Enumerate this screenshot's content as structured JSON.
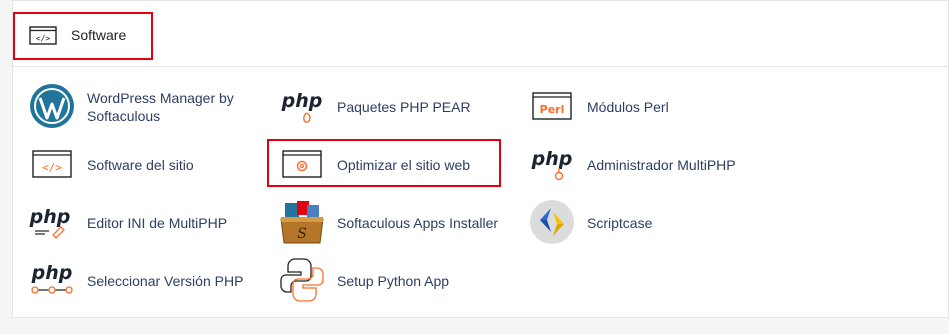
{
  "section": {
    "title": "Software",
    "icon": "code-window-icon"
  },
  "items": [
    {
      "label": "WordPress Manager by",
      "label2": "Softaculous",
      "icon": "wordpress-icon"
    },
    {
      "label": "Paquetes PHP PEAR",
      "icon": "php-pear-icon"
    },
    {
      "label": "Módulos Perl",
      "icon": "perl-icon",
      "icon_text": "Perl"
    },
    {
      "label": "Software del sitio",
      "icon": "code-window-icon"
    },
    {
      "label": "Optimizar el sitio web",
      "icon": "gear-window-icon"
    },
    {
      "label": "Administrador MultiPHP",
      "icon": "php-manager-icon"
    },
    {
      "label": "Editor INI de MultiPHP",
      "icon": "php-ini-editor-icon"
    },
    {
      "label": "Softaculous Apps Installer",
      "icon": "softaculous-icon"
    },
    {
      "label": "Scriptcase",
      "icon": "scriptcase-icon"
    },
    {
      "label": "Seleccionar Versión PHP",
      "icon": "php-version-icon"
    },
    {
      "label": "Setup Python App",
      "icon": "python-icon"
    }
  ],
  "icon_text": {
    "php": "php"
  },
  "colors": {
    "highlight": "#e3000f",
    "accent_orange": "#ff6c2c",
    "wordpress_blue": "#21759b",
    "link_text": "#2c3e64"
  }
}
